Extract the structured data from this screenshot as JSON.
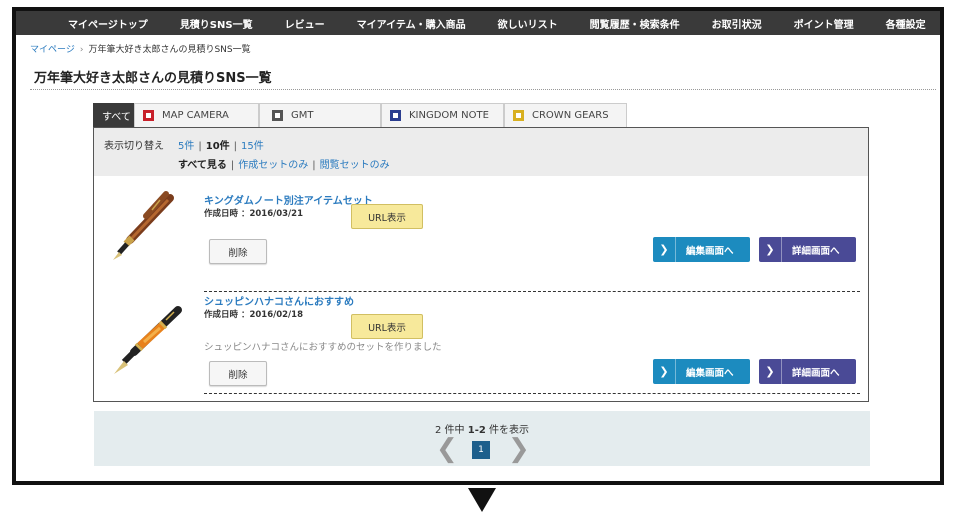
{
  "topnav": {
    "items": [
      {
        "label": "マイページトップ"
      },
      {
        "label": "見積りSNS一覧"
      },
      {
        "label": "レビュー"
      },
      {
        "label": "マイアイテム・購入商品"
      },
      {
        "label": "欲しいリスト"
      },
      {
        "label": "閲覧履歴・検索条件"
      },
      {
        "label": "お取引状況"
      },
      {
        "label": "ポイント管理"
      },
      {
        "label": "各種設定"
      }
    ]
  },
  "breadcrumb": {
    "home": "マイページ",
    "separator": "›",
    "current": "万年筆大好き太郎さんの見積りSNS一覧"
  },
  "page": {
    "title": "万年筆大好き太郎さんの見積りSNS一覧"
  },
  "tabs": [
    {
      "label": "すべて",
      "icon": "none",
      "active": true
    },
    {
      "label": "MAP CAMERA",
      "icon": "map-camera-logo-icon",
      "color": "#c8202a"
    },
    {
      "label": "GMT",
      "icon": "gmt-logo-icon",
      "color": "#555555"
    },
    {
      "label": "KINGDOM NOTE",
      "icon": "kingdom-note-logo-icon",
      "color": "#2a3d8f"
    },
    {
      "label": "CROWN GEARS",
      "icon": "crown-gears-logo-icon",
      "color": "#d8b020"
    }
  ],
  "filter": {
    "label": "表示切り替え",
    "counts": [
      "5件",
      "10件",
      "15件"
    ],
    "selected_count": "10件",
    "views": [
      "すべて見る",
      "作成セットのみ",
      "閲覧セットのみ"
    ],
    "selected_view": "すべて見る",
    "separator": "|"
  },
  "items": [
    {
      "title": "キングダムノート別注アイテムセット",
      "date": "作成日時 ：2016/03/21",
      "description": "",
      "url_button": "URL表示",
      "delete_button": "削除",
      "edit_button": "編集画面へ",
      "detail_button": "詳細画面へ"
    },
    {
      "title": "シュッピンハナコさんにおすすめ",
      "date": "作成日時 ：2016/02/18",
      "description": "シュッピンハナコさんにおすすめのセットを作りました",
      "url_button": "URL表示",
      "delete_button": "削除",
      "edit_button": "編集画面へ",
      "detail_button": "詳細画面へ"
    }
  ],
  "pager": {
    "total": "2",
    "total_suffix": " 件中 ",
    "range": "1-2",
    "range_suffix": " 件を表示",
    "prev": "❮",
    "next": "❯",
    "current_page": "1"
  },
  "colors": {
    "nav_bg": "#3a3a3a",
    "link": "#2b7bbf",
    "edit_button": "#1c8bbf",
    "detail_button": "#4a4a96",
    "url_button": "#f7e99b",
    "pager_bg": "#e4ecee",
    "current_page": "#1d5f8c"
  }
}
